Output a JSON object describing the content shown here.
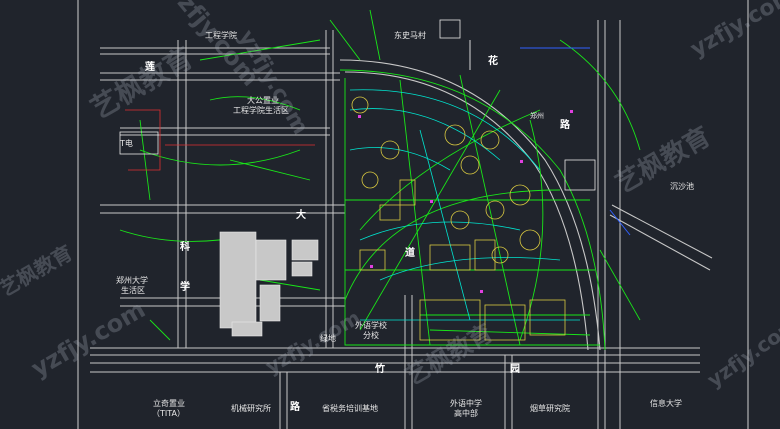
{
  "labels": {
    "gongcheng": "工程学院",
    "dongshima": "东史马村",
    "dagong_1": "大公置业",
    "dagong_2": "工程学院生活区",
    "tdian": "T电",
    "zhengda_1": "郑州大学",
    "zhengda_2": "生活区",
    "chengsha": "沉沙池",
    "waiyu_1": "外语学校",
    "waiyu_2": "分校",
    "lvdi": "绿地",
    "waiyu_mid_1": "外语中学",
    "waiyu_mid_2": "高中部",
    "zhengzhou_mark": "郑州"
  },
  "bottom_labels": {
    "liqi_1": "立奇置业",
    "liqi_2": "（TITA）",
    "jixie": "机械研究所",
    "shuiwu": "省税务培训基地",
    "yancao": "烟草研究院",
    "xinxi": "信息大学"
  },
  "road_chars": [
    "莲",
    "花",
    "路",
    "科",
    "学",
    "大",
    "道",
    "竹",
    "园",
    "路"
  ],
  "watermarks": [
    "艺枫教育",
    "yzfjy.com",
    "艺枫教育",
    "yzfjy.com",
    "yzfjy.com",
    "艺枫教育",
    "yzfjy.com",
    "yzfjy.com",
    "艺枫教育",
    "yzfjy.com"
  ],
  "colors": {
    "background": "#20242c",
    "road_line": "#c8c8c8",
    "green_line": "#19e619",
    "cyan_line": "#00e5d0",
    "building": "#d8c840",
    "gray_block": "#c8c8c8"
  }
}
